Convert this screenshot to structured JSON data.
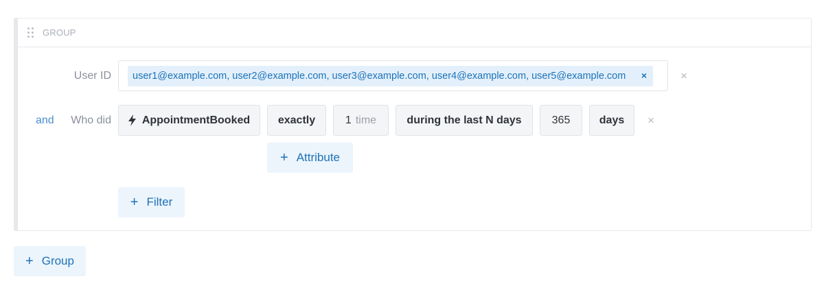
{
  "group": {
    "title": "GROUP",
    "user_id": {
      "label": "User ID",
      "chip_text": "user1@example.com, user2@example.com, user3@example.com, user4@example.com, user5@example.com",
      "chip_remove": "×",
      "row_remove": "×"
    },
    "event_filter": {
      "connector": "and",
      "label": "Who did",
      "event_name": "AppointmentBooked",
      "operator": "exactly",
      "count": "1",
      "count_unit": "time",
      "period": "during the last N days",
      "days_value": "365",
      "days_unit": "days",
      "row_remove": "×",
      "add_attribute_label": "Attribute"
    },
    "add_filter_label": "Filter"
  },
  "add_group_label": "Group",
  "icons": {
    "drag": "drag-handle-icon",
    "event": "lightning-icon",
    "plus": "plus-icon",
    "remove": "close-icon"
  },
  "colors": {
    "accent": "#1d72b8",
    "chip_bg": "#e3f0fb",
    "button_bg": "#ecf4fc",
    "connector": "#4a8fcf"
  }
}
